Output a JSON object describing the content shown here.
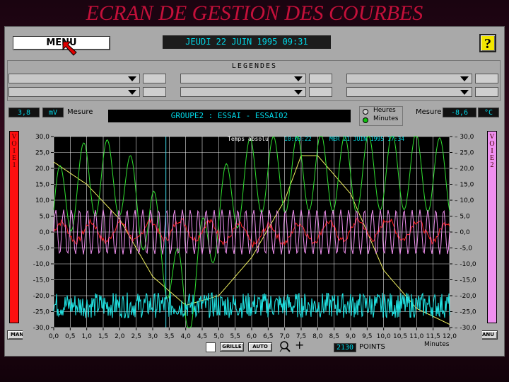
{
  "title": "ECRAN DE GESTION DES COURBES",
  "toolbar": {
    "menu_label": "MENU",
    "date": "JEUDI  22 JUIN 1995  09:31",
    "help_label": "?"
  },
  "legends": {
    "title": "LEGENDES"
  },
  "measure_left": {
    "value": "3,8",
    "unit": "mV",
    "label": "Mesure"
  },
  "measure_right": {
    "label": "Mesure",
    "value": "-8,6",
    "unit": "°C"
  },
  "group": "GROUPE2 : ESSAI - ESSAI02",
  "time_options": {
    "hours": "Heures",
    "minutes": "Minutes",
    "selected": "Minutes"
  },
  "voie1": {
    "label": "VOIE1",
    "color": "#ff1010"
  },
  "voie2": {
    "label": "VOIE2",
    "color": "#f090f0"
  },
  "manu_label": "MANU",
  "bottom": {
    "grille": "GRILLE",
    "auto": "AUTO",
    "points_value": "2130",
    "points_label": "POINTS"
  },
  "chart_data": {
    "type": "line",
    "header": {
      "label": "Temps absolu",
      "time": "10:03:22",
      "date": "MER 21 JUIN 1995  17:34"
    },
    "xlabel": "Minutes",
    "xlim": [
      0,
      12
    ],
    "ylim": [
      -30,
      30
    ],
    "x_ticks": [
      "0,0",
      "0,5",
      "1,0",
      "1,5",
      "2,0",
      "2,5",
      "3,0",
      "3,5",
      "4,0",
      "4,5",
      "5,0",
      "5,5",
      "6,0",
      "6,5",
      "7,0",
      "7,5",
      "8,0",
      "8,5",
      "9,0",
      "9,5",
      "10,0",
      "10,5",
      "11,0",
      "11,5",
      "12,0"
    ],
    "y_ticks": [
      "30,0",
      "25,0",
      "20,0",
      "15,0",
      "10,0",
      "5,0",
      "0,0",
      "-5,0",
      "-10,0",
      "-15,0",
      "-20,0",
      "-25,0",
      "-30,0"
    ],
    "cursor_x": 3.4,
    "grid": true,
    "series": [
      {
        "color": "#f0f060",
        "x": [
          0,
          1,
          2,
          3,
          4,
          5,
          6,
          7,
          7.5,
          8,
          9,
          10,
          11,
          12
        ],
        "values": [
          22,
          15,
          4,
          -14,
          -23,
          -20,
          -8,
          10,
          24,
          24,
          12,
          -12,
          -24,
          -29
        ]
      },
      {
        "color": "#30e030",
        "x": [
          0,
          1,
          2,
          3,
          4,
          5,
          6,
          7,
          8,
          9,
          10,
          11,
          12
        ],
        "values": [
          10,
          20,
          20,
          5,
          -20,
          10,
          21,
          21,
          22,
          21,
          22,
          22,
          20
        ],
        "amplitude": 15
      },
      {
        "color": "#ff2020",
        "x": [
          0,
          2,
          4,
          6,
          8,
          10,
          12
        ],
        "values": [
          0,
          0,
          1,
          -1,
          0,
          1,
          0
        ],
        "amplitude": 3
      },
      {
        "color": "#f090f0",
        "x": [
          0,
          12
        ],
        "values": [
          0,
          0
        ],
        "amplitude": 7
      },
      {
        "color": "#20e0e0",
        "x": [
          0,
          12
        ],
        "values": [
          -23,
          -23
        ],
        "amplitude": 4
      }
    ]
  }
}
